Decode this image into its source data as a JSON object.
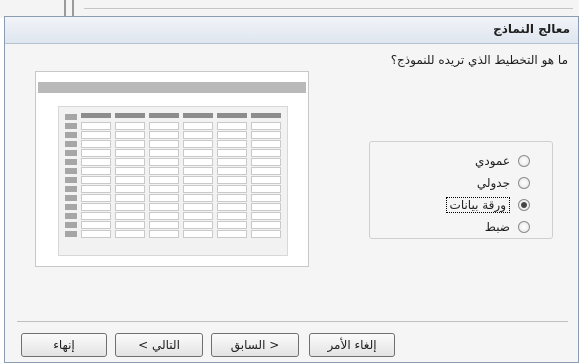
{
  "window": {
    "title": "معالج النماذج"
  },
  "question": "ما هو التخطيط الذي تريده للنموذج؟",
  "options": [
    {
      "label": "عمودي",
      "checked": false
    },
    {
      "label": "جدولي",
      "checked": false
    },
    {
      "label": "ورقة بيانات",
      "checked": true
    },
    {
      "label": "ضبط",
      "checked": false
    }
  ],
  "buttons": {
    "cancel": "إلغاء الأمر",
    "back": "< السابق",
    "next": "التالي >",
    "finish": "إنهاء"
  }
}
